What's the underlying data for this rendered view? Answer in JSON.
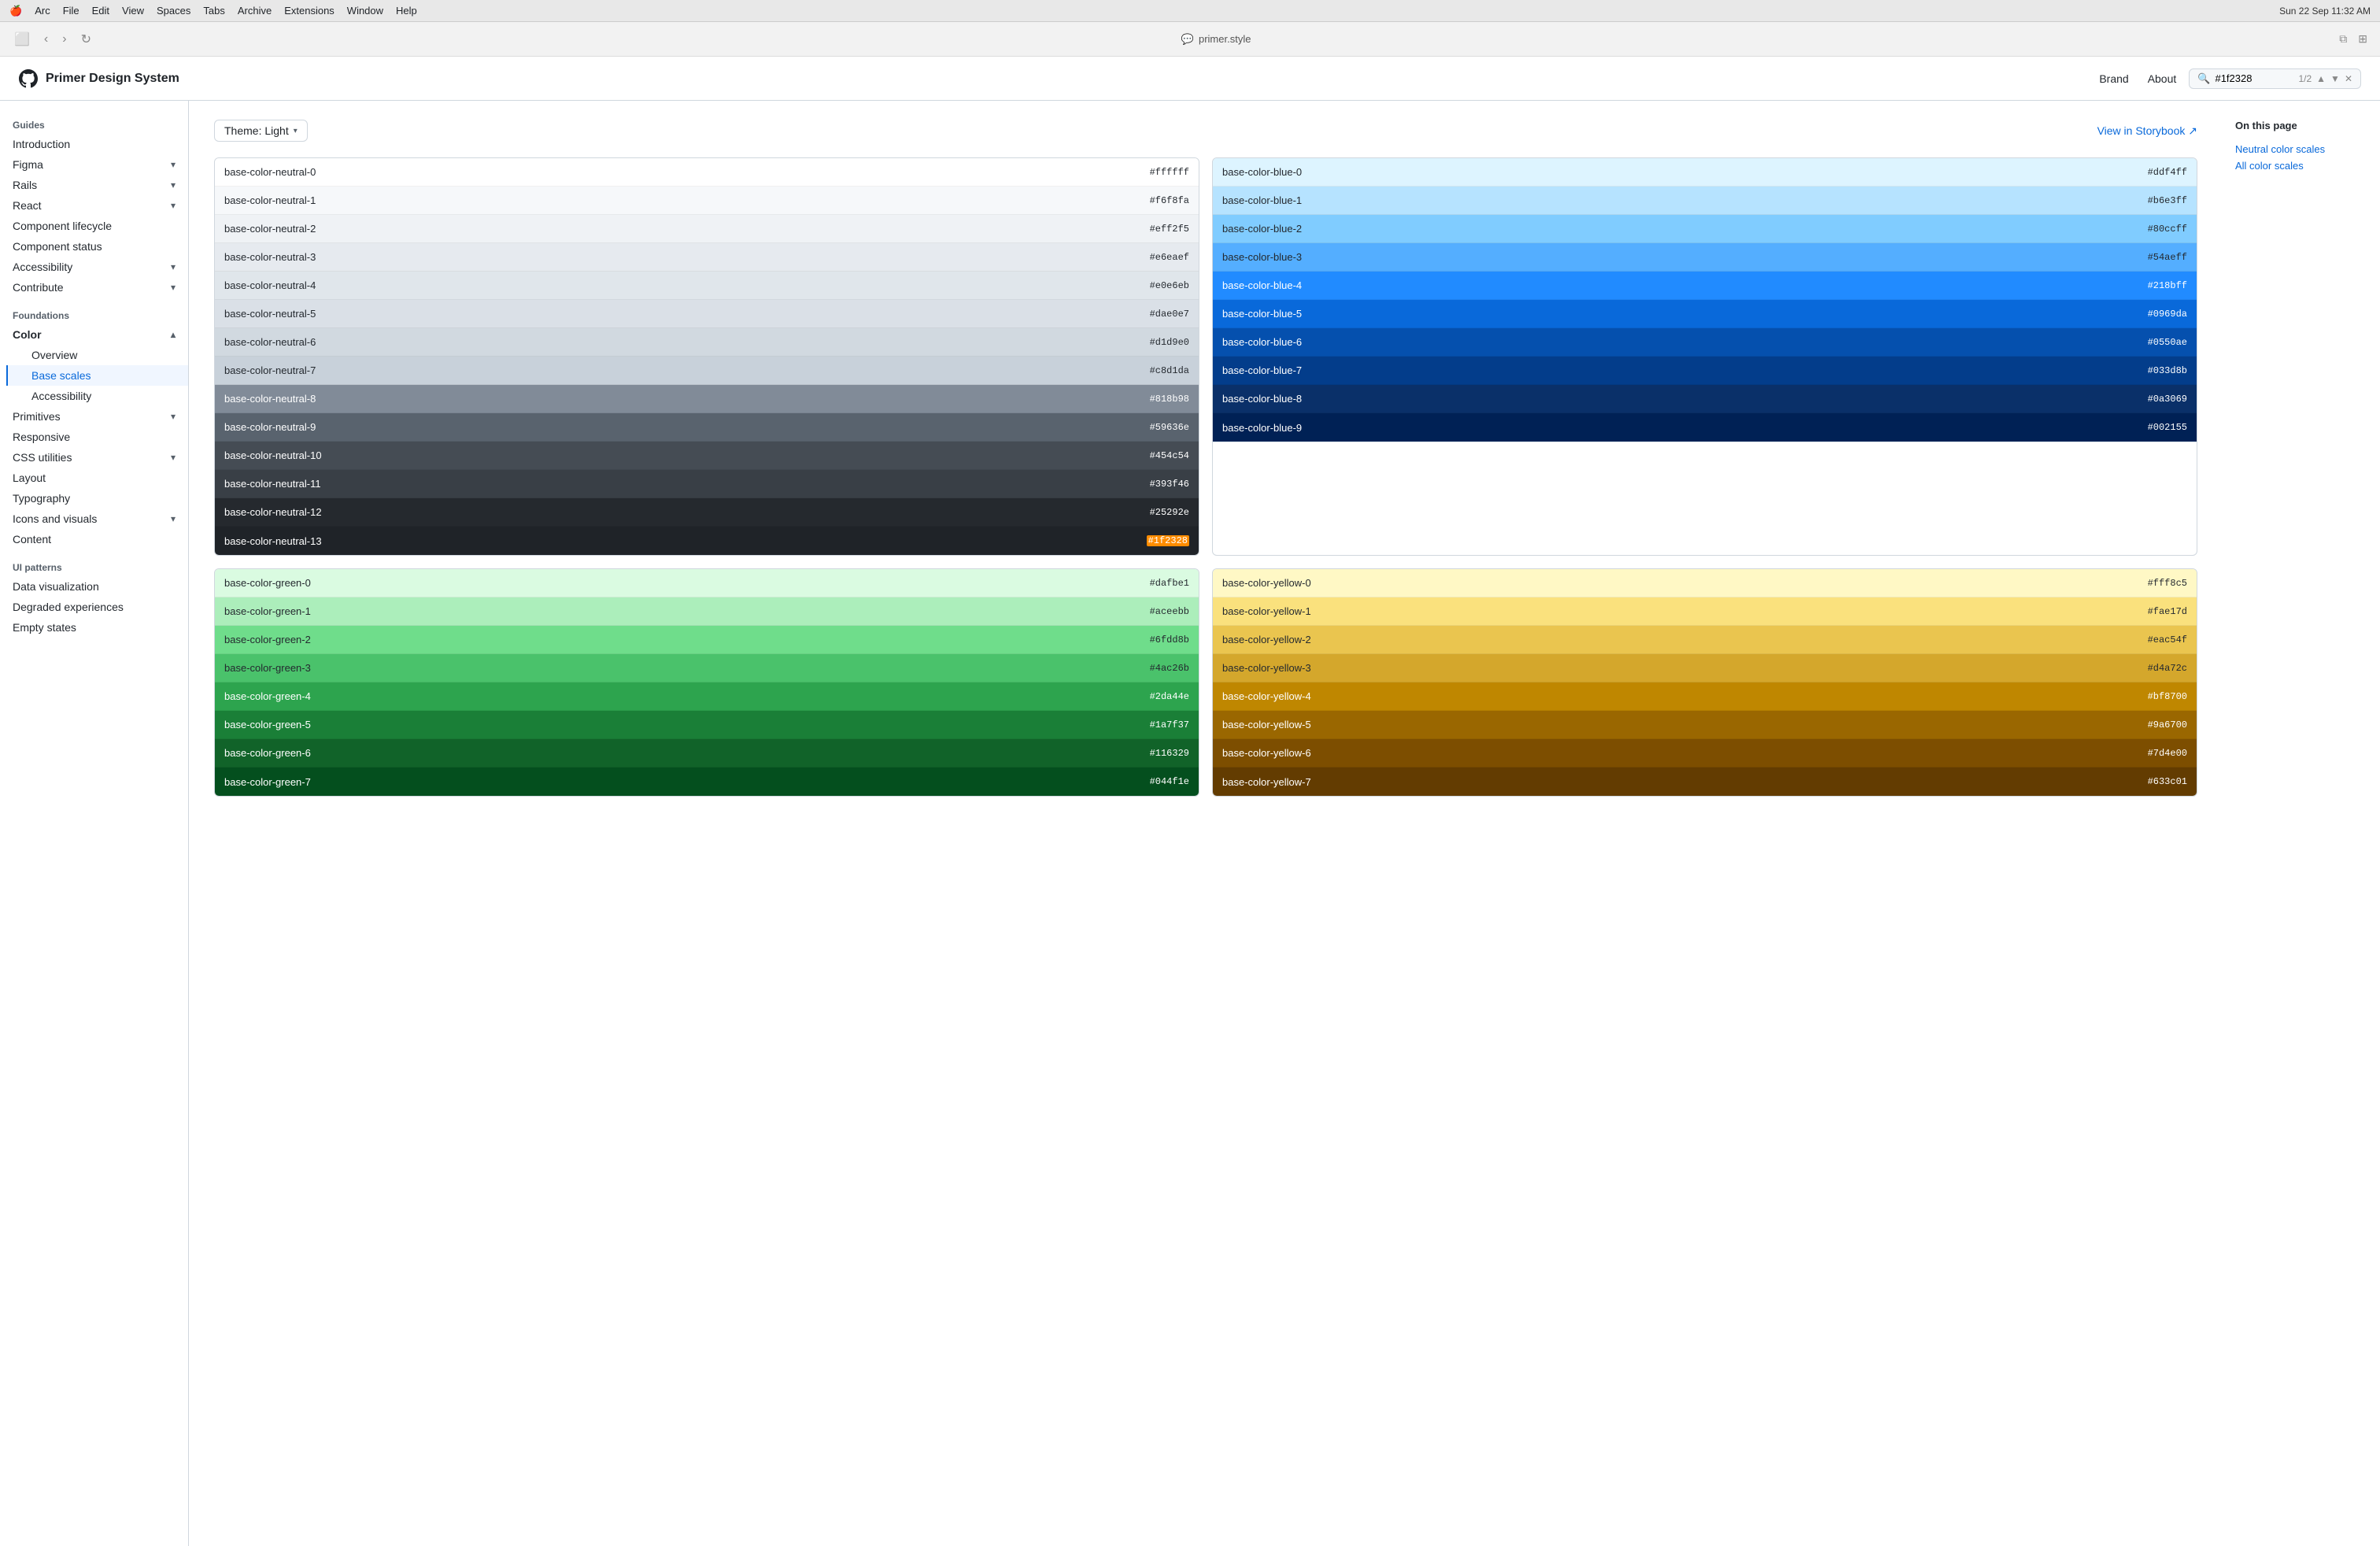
{
  "menubar": {
    "items": [
      "🍎",
      "Arc",
      "File",
      "Edit",
      "View",
      "Spaces",
      "Tabs",
      "Archive",
      "Extensions",
      "Window",
      "Help"
    ]
  },
  "browser": {
    "url": "primer.style",
    "url_icon": "💬",
    "time": "Sun 22 Sep  11:32 AM",
    "search_query": "#1f2328",
    "search_count": "1/2"
  },
  "site": {
    "logo_text": "Primer Design System",
    "nav": {
      "brand": "Brand",
      "about": "About"
    },
    "search": {
      "value": "#1f2328",
      "count": "1/2"
    }
  },
  "sidebar": {
    "guides_label": "Guides",
    "introduction": "Introduction",
    "figma": "Figma",
    "rails": "Rails",
    "react": "React",
    "component_lifecycle": "Component lifecycle",
    "component_status": "Component status",
    "accessibility": "Accessibility",
    "contribute": "Contribute",
    "foundations_label": "Foundations",
    "color": "Color",
    "color_overview": "Overview",
    "color_base_scales": "Base scales",
    "color_accessibility": "Accessibility",
    "primitives": "Primitives",
    "responsive": "Responsive",
    "css_utilities": "CSS utilities",
    "layout": "Layout",
    "typography": "Typography",
    "icons_and_visuals": "Icons and visuals",
    "content": "Content",
    "ui_patterns_label": "UI patterns",
    "data_visualization": "Data visualization",
    "degraded_experiences": "Degraded experiences",
    "empty_states": "Empty states"
  },
  "toc": {
    "title": "On this page",
    "items": [
      "Neutral color scales",
      "All color scales"
    ]
  },
  "theme": {
    "label": "Theme: Light",
    "storybook_link": "View in Storybook ↗"
  },
  "neutral_colors": [
    {
      "name": "base-color-neutral-0",
      "hex": "#ffffff",
      "class": "neutral-0"
    },
    {
      "name": "base-color-neutral-1",
      "hex": "#f6f8fa",
      "class": "neutral-1"
    },
    {
      "name": "base-color-neutral-2",
      "hex": "#eff2f5",
      "class": "neutral-2"
    },
    {
      "name": "base-color-neutral-3",
      "hex": "#e6eaef",
      "class": "neutral-3"
    },
    {
      "name": "base-color-neutral-4",
      "hex": "#e0e6eb",
      "class": "neutral-4"
    },
    {
      "name": "base-color-neutral-5",
      "hex": "#dae0e7",
      "class": "neutral-5"
    },
    {
      "name": "base-color-neutral-6",
      "hex": "#d1d9e0",
      "class": "neutral-6"
    },
    {
      "name": "base-color-neutral-7",
      "hex": "#c8d1da",
      "class": "neutral-7"
    },
    {
      "name": "base-color-neutral-8",
      "hex": "#818b98",
      "class": "neutral-8"
    },
    {
      "name": "base-color-neutral-9",
      "hex": "#59636e",
      "class": "neutral-9"
    },
    {
      "name": "base-color-neutral-10",
      "hex": "#454c54",
      "class": "neutral-10"
    },
    {
      "name": "base-color-neutral-11",
      "hex": "#393f46",
      "class": "neutral-11"
    },
    {
      "name": "base-color-neutral-12",
      "hex": "#25292e",
      "class": "neutral-12"
    },
    {
      "name": "base-color-neutral-13",
      "hex": "#1f2328",
      "class": "neutral-13",
      "highlight": true
    }
  ],
  "blue_colors": [
    {
      "name": "base-color-blue-0",
      "hex": "#ddf4ff",
      "class": "blue-0"
    },
    {
      "name": "base-color-blue-1",
      "hex": "#b6e3ff",
      "class": "blue-1"
    },
    {
      "name": "base-color-blue-2",
      "hex": "#80ccff",
      "class": "blue-2"
    },
    {
      "name": "base-color-blue-3",
      "hex": "#54aeff",
      "class": "blue-3"
    },
    {
      "name": "base-color-blue-4",
      "hex": "#218bff",
      "class": "blue-4"
    },
    {
      "name": "base-color-blue-5",
      "hex": "#0969da",
      "class": "blue-5"
    },
    {
      "name": "base-color-blue-6",
      "hex": "#0550ae",
      "class": "blue-6"
    },
    {
      "name": "base-color-blue-7",
      "hex": "#033d8b",
      "class": "blue-7"
    },
    {
      "name": "base-color-blue-8",
      "hex": "#0a3069",
      "class": "blue-8"
    },
    {
      "name": "base-color-blue-9",
      "hex": "#002155",
      "class": "blue-9"
    }
  ],
  "green_colors": [
    {
      "name": "base-color-green-0",
      "hex": "#dafbe1",
      "class": "green-0"
    },
    {
      "name": "base-color-green-1",
      "hex": "#aceebb",
      "class": "green-1"
    },
    {
      "name": "base-color-green-2",
      "hex": "#6fdd8b",
      "class": "green-2"
    },
    {
      "name": "base-color-green-3",
      "hex": "#4ac26b",
      "class": "green-3"
    },
    {
      "name": "base-color-green-4",
      "hex": "#2da44e",
      "class": "green-4"
    },
    {
      "name": "base-color-green-5",
      "hex": "#1a7f37",
      "class": "green-5"
    },
    {
      "name": "base-color-green-6",
      "hex": "#116329",
      "class": "green-6"
    },
    {
      "name": "base-color-green-7",
      "hex": "#044f1e",
      "class": "green-7"
    }
  ],
  "yellow_colors": [
    {
      "name": "base-color-yellow-0",
      "hex": "#fff8c5",
      "class": "yellow-0"
    },
    {
      "name": "base-color-yellow-1",
      "hex": "#fae17d",
      "class": "yellow-1"
    },
    {
      "name": "base-color-yellow-2",
      "hex": "#eac54f",
      "class": "yellow-2"
    },
    {
      "name": "base-color-yellow-3",
      "hex": "#d4a72c",
      "class": "yellow-3"
    },
    {
      "name": "base-color-yellow-4",
      "hex": "#bf8700",
      "class": "yellow-4"
    },
    {
      "name": "base-color-yellow-5",
      "hex": "#9a6700",
      "class": "yellow-5"
    },
    {
      "name": "base-color-yellow-6",
      "hex": "#7d4e00",
      "class": "yellow-6"
    },
    {
      "name": "base-color-yellow-7",
      "hex": "#633c01",
      "class": "yellow-7"
    }
  ]
}
